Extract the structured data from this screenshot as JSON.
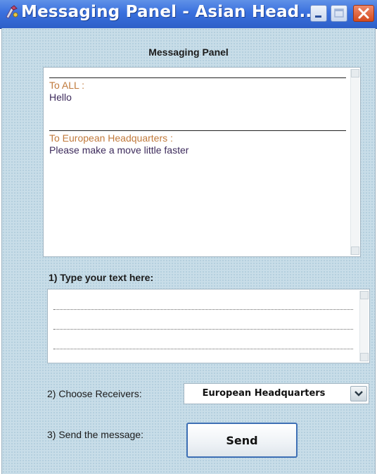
{
  "window": {
    "title": "Messaging Panel -  Asian Head..."
  },
  "icons": {
    "app": "app-icon",
    "minimize": "minimize-icon",
    "maximize": "maximize-icon",
    "close": "close-icon",
    "dropdown": "chevron-down-icon"
  },
  "panel": {
    "title": "Messaging Panel",
    "messages": [
      {
        "to": "To ALL :",
        "body": "Hello"
      },
      {
        "to": "To European Headquarters :",
        "body": "Please make a move little faster"
      }
    ],
    "step1_label": "1) Type your text here:",
    "message_input_value": "",
    "step2_label": "2) Choose Receivers:",
    "receivers_selected": "European Headquarters",
    "step3_label": "3) Send the message:",
    "send_label": "Send"
  },
  "colors": {
    "titlebar": "#3a70de",
    "panel_bg": "#c8dde8",
    "recipient_text": "#c0793b",
    "message_text": "#3d2b5c",
    "close_button": "#d34a1e"
  }
}
